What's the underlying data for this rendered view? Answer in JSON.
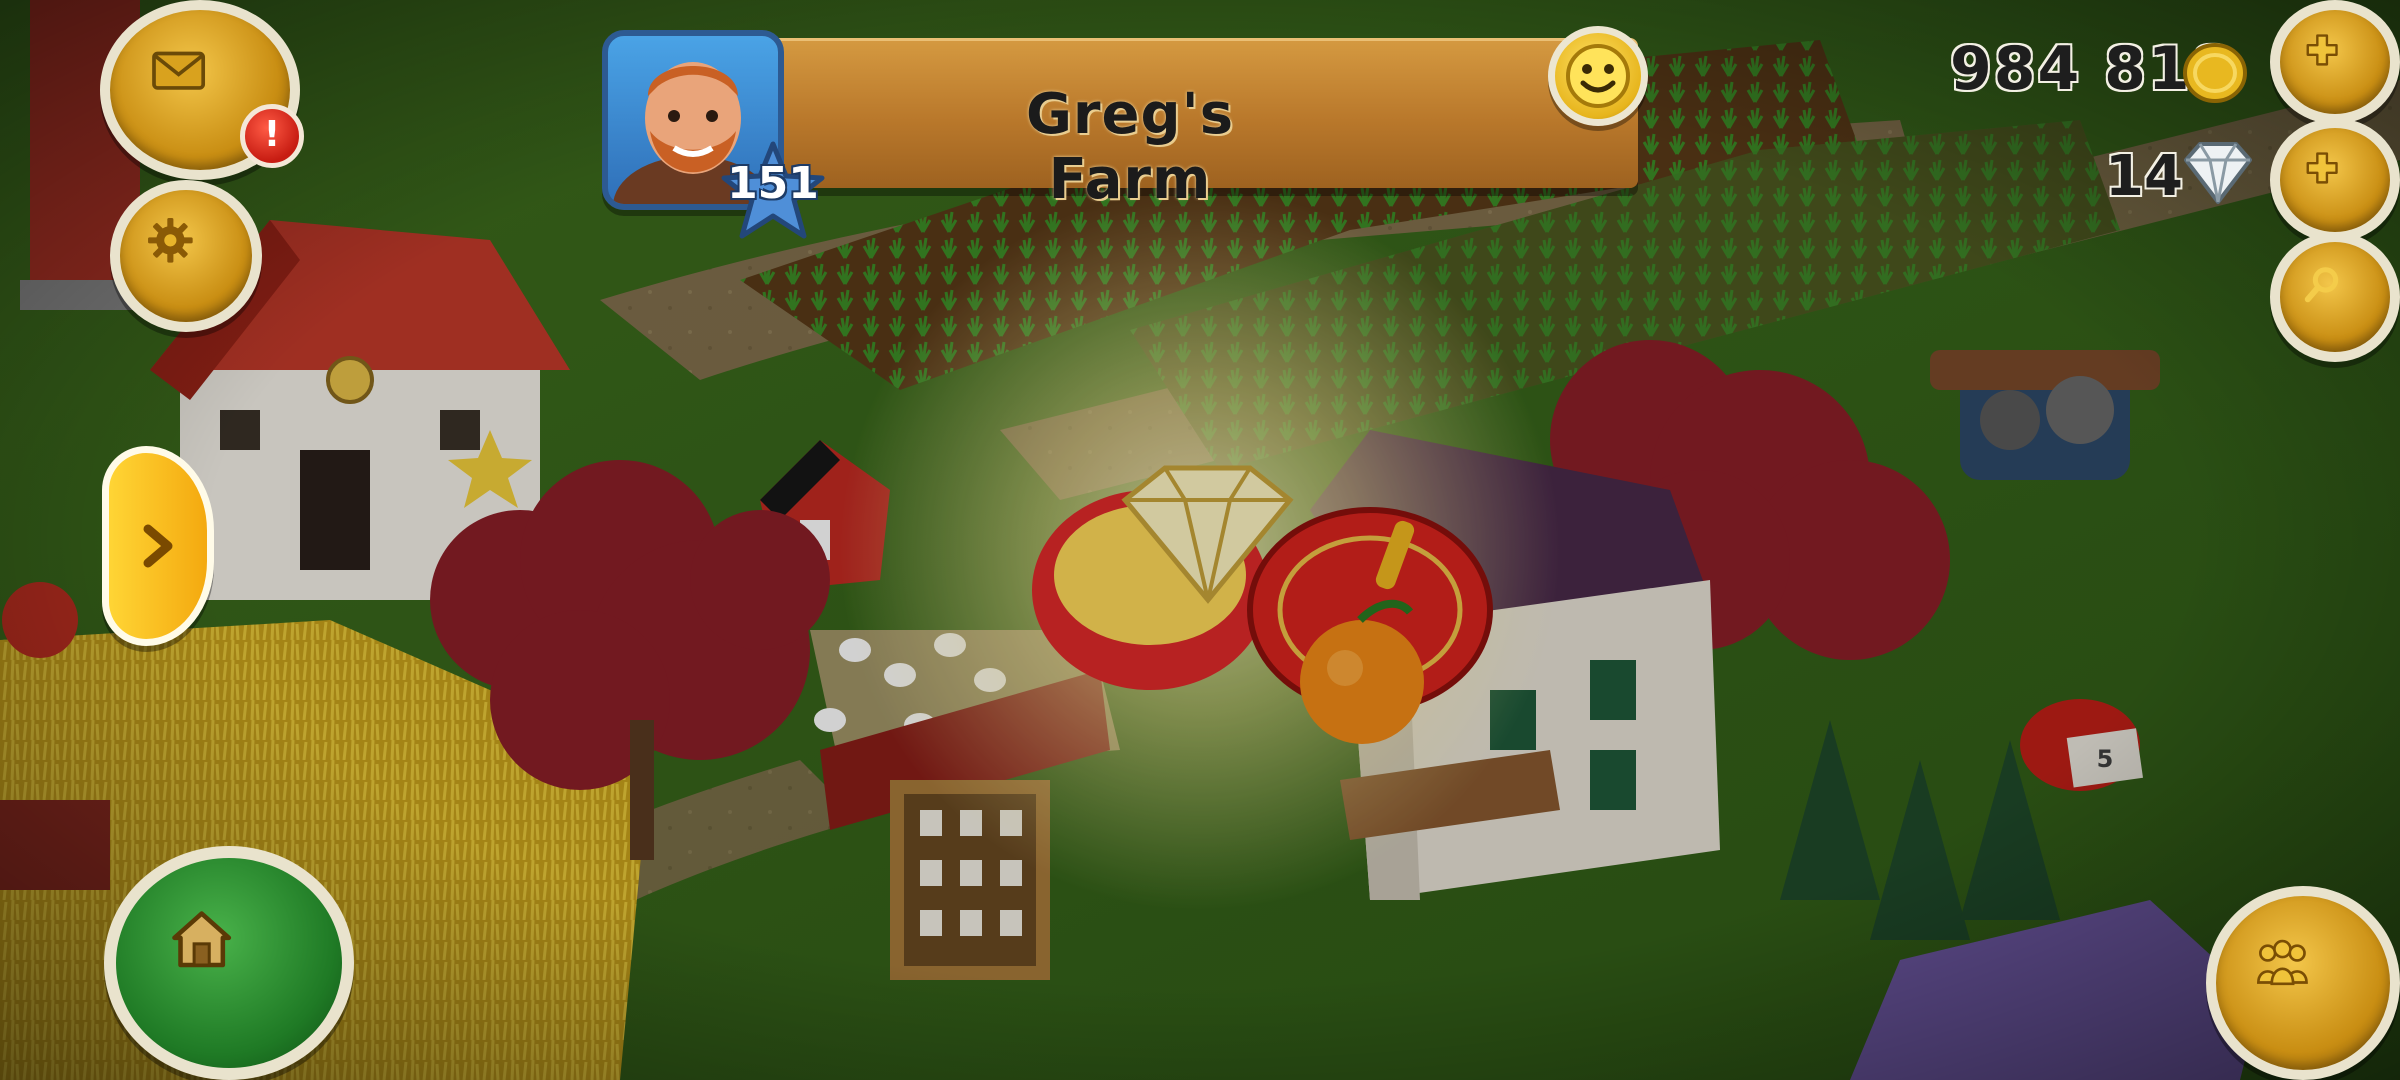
{
  "header": {
    "farm_name": "Greg's Farm",
    "level": "151"
  },
  "resources": {
    "coins": "984 818",
    "diamonds": "14"
  },
  "notifications": {
    "mail_badge": "!"
  },
  "world": {
    "sign_number": "5"
  },
  "icons": {
    "mail": "mail-icon",
    "settings": "gear-icon",
    "expand_panel": "chevron-right-icon",
    "home": "home-icon",
    "smiley": "smiley-icon",
    "add_coins": "plus-icon",
    "add_diamonds": "plus-icon",
    "search": "magnifier-icon",
    "friends": "friends-icon",
    "coin": "coin-icon",
    "diamond": "diamond-icon"
  },
  "colors": {
    "button_gold": "#d9a21e",
    "header_wood": "#c3853a",
    "home_green": "#2a8a2f",
    "badge_red": "#d22a1c"
  }
}
